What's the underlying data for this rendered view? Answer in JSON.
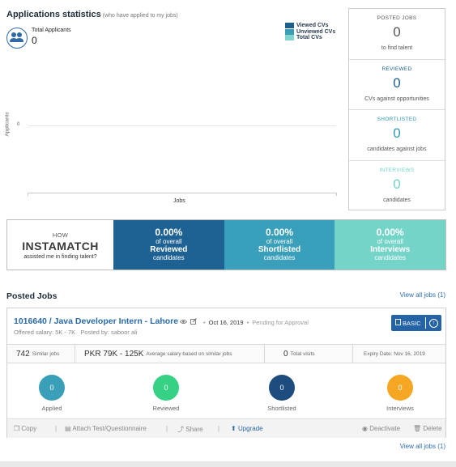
{
  "stats": {
    "title": "Applications statistics",
    "subtitle": "(who have applied to my jobs)",
    "total_label": "Total Applicants",
    "total_value": "0"
  },
  "chart_data": {
    "type": "bar",
    "categories": [],
    "series": [
      {
        "name": "Viewed CVs",
        "color": "#1b5f8c",
        "values": []
      },
      {
        "name": "Unviewed CVs",
        "color": "#3a9fb3",
        "values": []
      },
      {
        "name": "Total CVs",
        "color": "#7fd4cf",
        "values": []
      }
    ],
    "xlabel": "Jobs",
    "ylabel": "Applicants",
    "y_ticks": [
      "0"
    ],
    "legend_placement": "top-right",
    "grid": true
  },
  "cards": [
    {
      "title": "POSTED JOBS",
      "value": "0",
      "desc": "to find talent",
      "color": "#555555",
      "value_color": "#555555"
    },
    {
      "title": "REVIEWED",
      "value": "0",
      "desc": "CVs against opportunities",
      "color": "#1d5f93",
      "value_color": "#1d5f93"
    },
    {
      "title": "SHORTLISTED",
      "value": "0",
      "desc": "candidates against jobs",
      "color": "#3199b1",
      "value_color": "#3199b1"
    },
    {
      "title": "INTERVIEWS",
      "value": "0",
      "desc": "candidates",
      "color": "#6fd3cb",
      "value_color": "#6fd3cb"
    }
  ],
  "instamatch": {
    "how": "HOW",
    "brand": "INSTAMATCH",
    "sub": "assisted me in finding talent?",
    "blocks": [
      {
        "pct": "0.00%",
        "overall": "of overall",
        "label": "Reviewed",
        "cand": "candidates",
        "color": "#1e6193"
      },
      {
        "pct": "0.00%",
        "overall": "of overall",
        "label": "Shortlisted",
        "cand": "candidates",
        "color": "#3a9fbb"
      },
      {
        "pct": "0.00%",
        "overall": "of overall",
        "label": "Interviews",
        "cand": "candidates",
        "color": "#74d4c8"
      }
    ]
  },
  "posted": {
    "title": "Posted Jobs",
    "view_all": "View all jobs (1)"
  },
  "job": {
    "title": "1016640 / Java Developer Intern - Lahore",
    "date": "Oct 16, 2019",
    "status": "Pending for Approval",
    "salary": "Offered salary: 5K - 7K",
    "posted_by": "Posted by: saboor ali",
    "plan": "BASIC",
    "similar_count": "742",
    "similar_label": "Similar jobs",
    "avg_salary": "PKR 79K - 125K",
    "avg_label": "Average salary based on similar jobs",
    "visits_count": "0",
    "visits_label": "Total visits",
    "expiry": "Expiry Date: Nov 16, 2019",
    "pipeline": [
      {
        "label": "Applied",
        "value": "0",
        "color": "#3a9fb8"
      },
      {
        "label": "Reviewed",
        "value": "0",
        "color": "#35d184"
      },
      {
        "label": "Shortlisted",
        "value": "0",
        "color": "#1d4c7f"
      },
      {
        "label": "Interviews",
        "value": "0",
        "color": "#f5a623"
      }
    ],
    "actions": {
      "copy": "Copy",
      "attach": "Attach Test/Questionnaire",
      "share": "Share",
      "upgrade": "Upgrade",
      "deactivate": "Deactivate",
      "delete": "Delete"
    }
  }
}
